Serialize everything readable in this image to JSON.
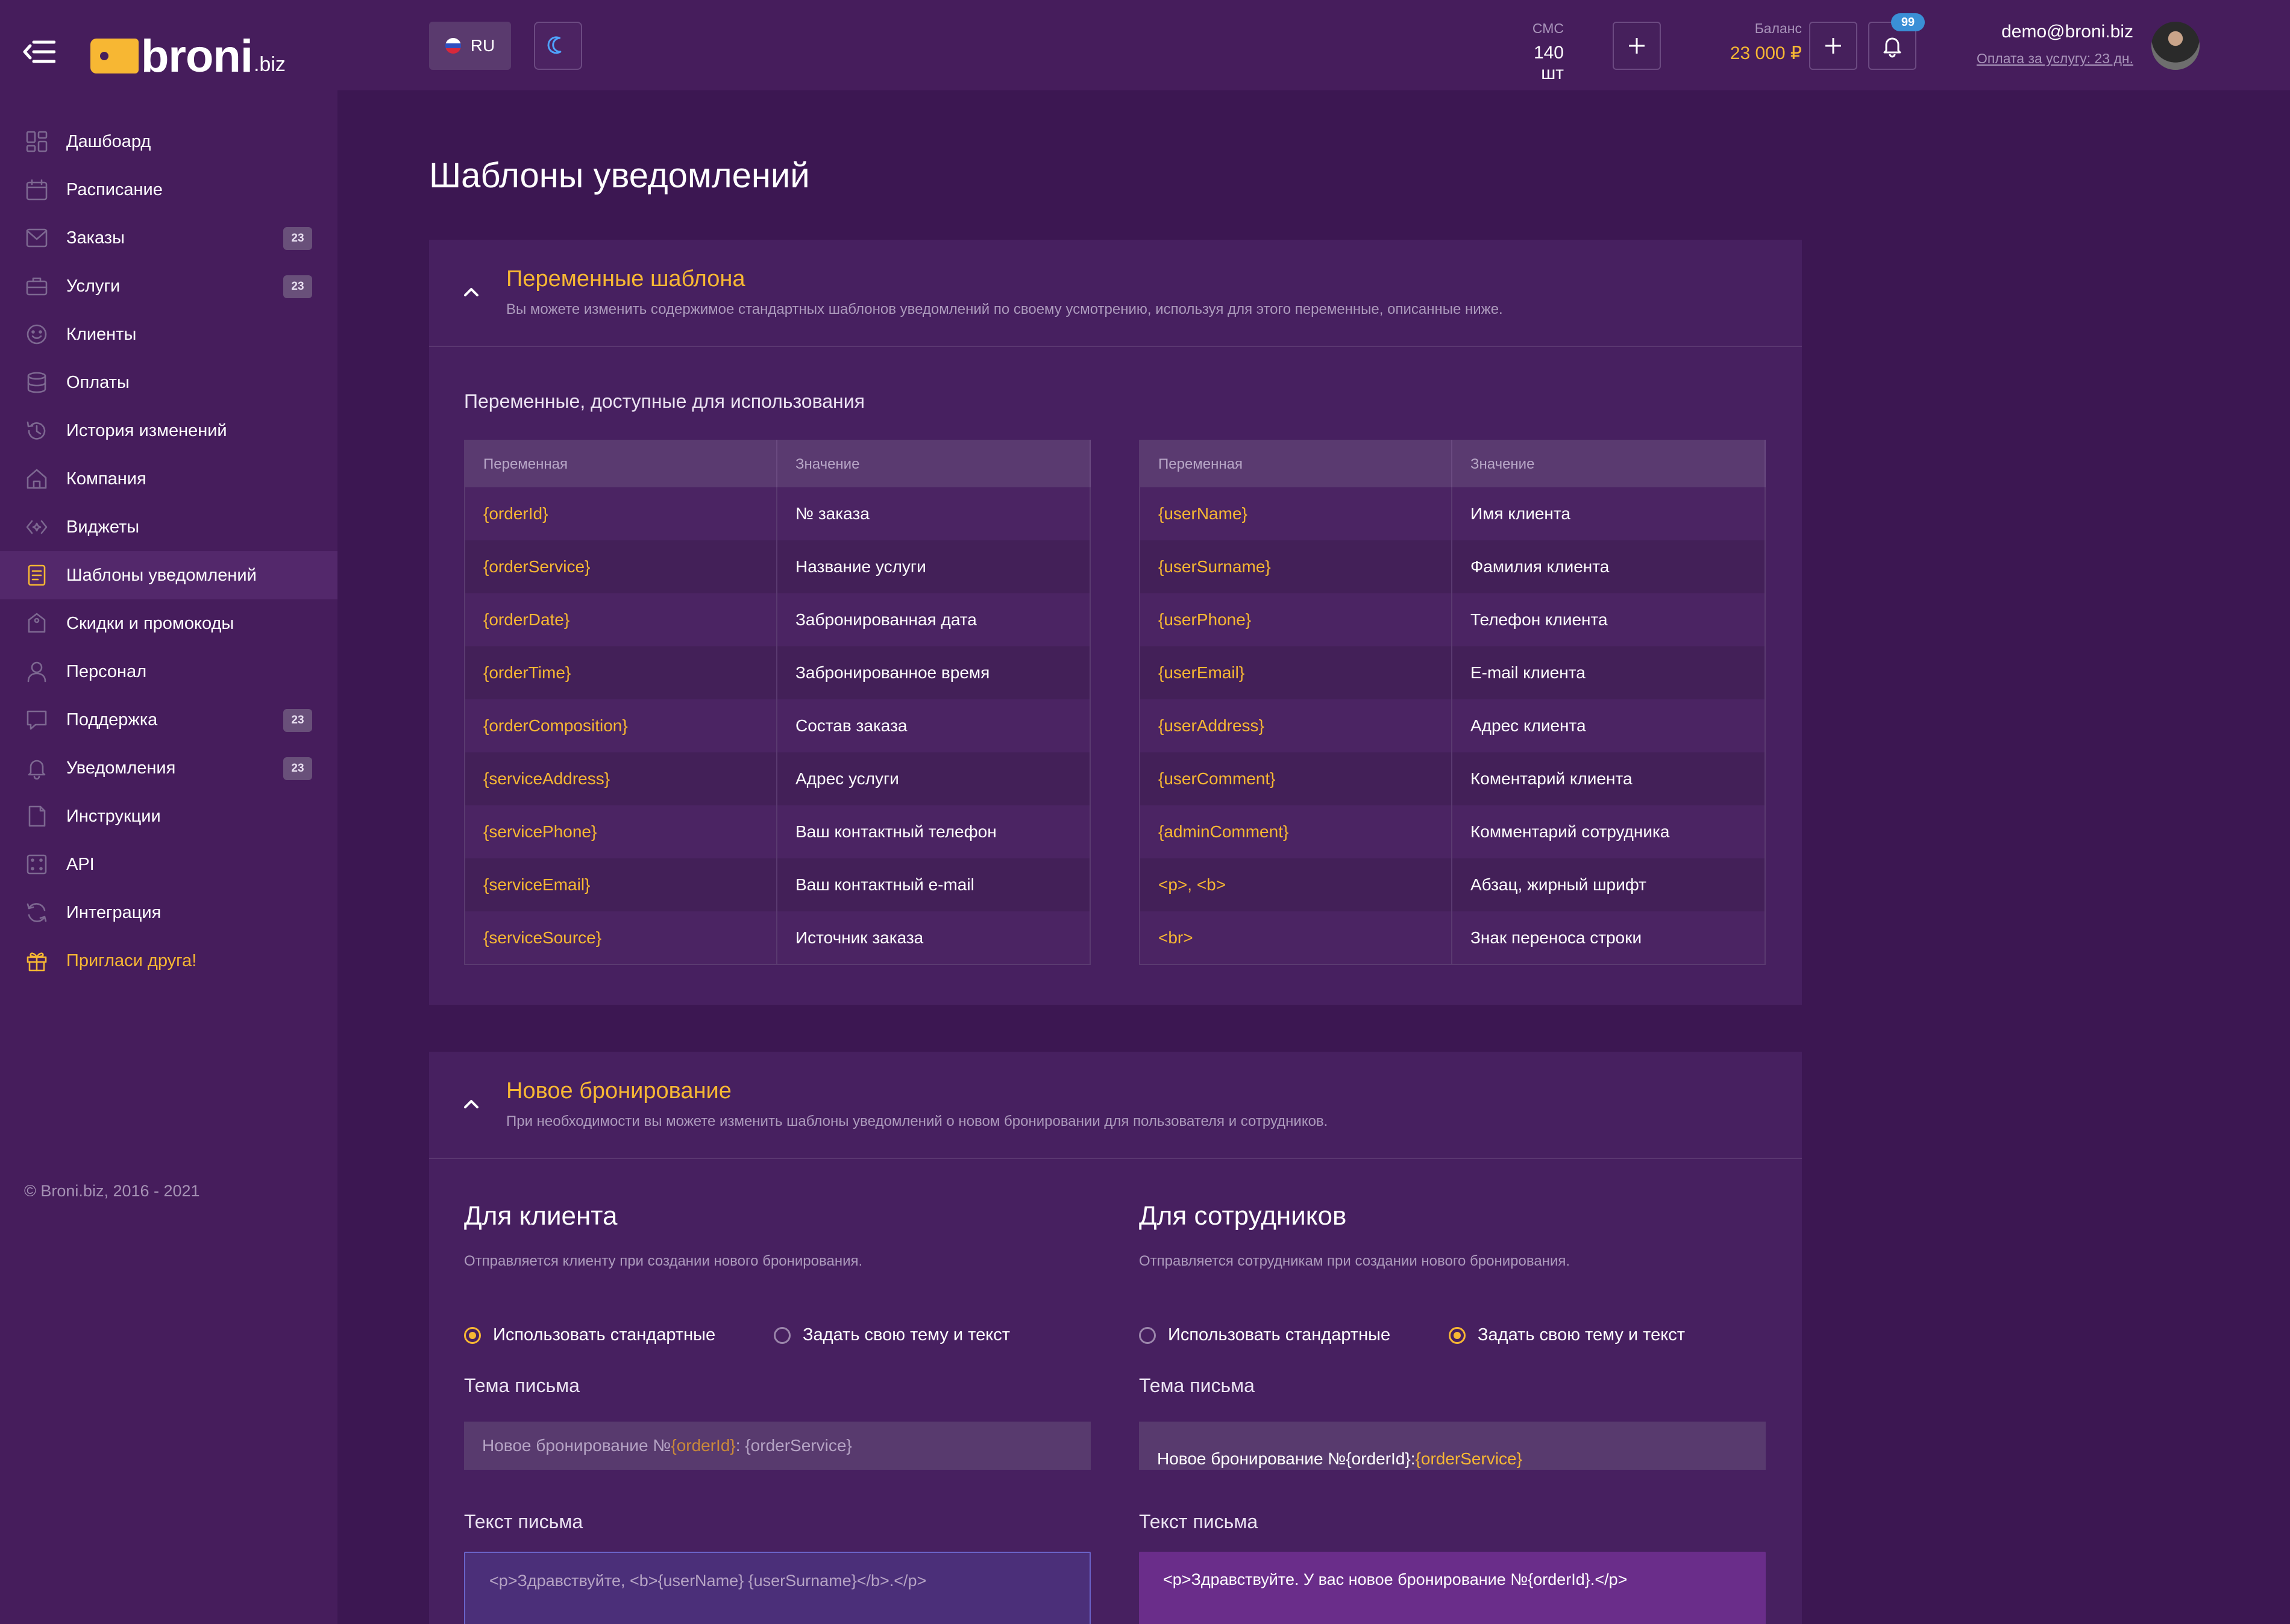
{
  "brand": {
    "logo_main": "broni",
    "logo_sub": ".biz"
  },
  "sidebar": {
    "items": [
      {
        "label": "Дашбоард",
        "icon": "dashboard-icon",
        "badge": ""
      },
      {
        "label": "Расписание",
        "icon": "calendar-icon",
        "badge": ""
      },
      {
        "label": "Заказы",
        "icon": "orders-icon",
        "badge": "23"
      },
      {
        "label": "Услуги",
        "icon": "briefcase-icon",
        "badge": "23"
      },
      {
        "label": "Клиенты",
        "icon": "smile-icon",
        "badge": ""
      },
      {
        "label": "Оплаты",
        "icon": "database-icon",
        "badge": ""
      },
      {
        "label": "История изменений",
        "icon": "history-icon",
        "badge": ""
      },
      {
        "label": "Компания",
        "icon": "home-icon",
        "badge": ""
      },
      {
        "label": "Виджеты",
        "icon": "widget-icon",
        "badge": ""
      },
      {
        "label": "Шаблоны уведомлений",
        "icon": "template-icon",
        "badge": ""
      },
      {
        "label": "Скидки и промокоды",
        "icon": "discount-icon",
        "badge": ""
      },
      {
        "label": "Персонал",
        "icon": "user-icon",
        "badge": ""
      },
      {
        "label": "Поддержка",
        "icon": "chat-icon",
        "badge": "23"
      },
      {
        "label": "Уведомления",
        "icon": "bell-icon",
        "badge": "23"
      },
      {
        "label": "Инструкции",
        "icon": "document-icon",
        "badge": ""
      },
      {
        "label": "API",
        "icon": "api-icon",
        "badge": ""
      },
      {
        "label": "Интеграция",
        "icon": "sync-icon",
        "badge": ""
      },
      {
        "label": "Пригласи друга!",
        "icon": "gift-icon",
        "badge": ""
      }
    ],
    "active_index": 9,
    "copyright": "© Broni.biz, 2016 - 2021"
  },
  "header": {
    "language": "RU",
    "sms": {
      "label": "СМС",
      "value": "140 шт"
    },
    "balance": {
      "label": "Баланс",
      "value": "23 000 ₽"
    },
    "notifications_count": "99",
    "user_email": "demo@broni.biz",
    "payment_info": "Оплата за услугу: 23 дн."
  },
  "page_title": "Шаблоны уведомлений",
  "variables_card": {
    "title": "Переменные шаблона",
    "subtitle": "Вы можете изменить содержимое стандартных шаблонов уведомлений по своему усмотрению, используя для этого переменные, описанные ниже.",
    "caption": "Переменные, доступные для использования",
    "col_var": "Переменная",
    "col_val": "Значение",
    "left": [
      {
        "var": "{orderId}",
        "val": "№ заказа"
      },
      {
        "var": "{orderService}",
        "val": "Название услуги"
      },
      {
        "var": "{orderDate}",
        "val": "Забронированная дата"
      },
      {
        "var": "{orderTime}",
        "val": "Забронированное время"
      },
      {
        "var": "{orderComposition}",
        "val": "Состав заказа"
      },
      {
        "var": "{serviceAddress}",
        "val": "Адрес услуги"
      },
      {
        "var": "{servicePhone}",
        "val": "Ваш контактный телефон"
      },
      {
        "var": "{serviceEmail}",
        "val": "Ваш контактный e-mail"
      },
      {
        "var": "{serviceSource}",
        "val": "Источник заказа"
      }
    ],
    "right": [
      {
        "var": "{userName}",
        "val": "Имя клиента"
      },
      {
        "var": "{userSurname}",
        "val": "Фамилия клиента"
      },
      {
        "var": "{userPhone}",
        "val": "Телефон клиента"
      },
      {
        "var": "{userEmail}",
        "val": "E-mail клиента"
      },
      {
        "var": "{userAddress}",
        "val": "Адрес клиента"
      },
      {
        "var": "{userComment}",
        "val": "Коментарий клиента"
      },
      {
        "var": "{adminComment}",
        "val": "Комментарий сотрудника"
      },
      {
        "var": "<p>, <b>",
        "val": "Абзац, жирный шрифт"
      },
      {
        "var": "<br>",
        "val": "Знак переноса строки"
      }
    ]
  },
  "booking_card": {
    "title": "Новое бронирование",
    "subtitle": "При необходимости вы можете изменить шаблоны уведомлений о новом бронировании для пользователя и сотрудников.",
    "client": {
      "title": "Для клиента",
      "subtitle": "Отправляется клиенту при создании нового бронирования.",
      "option_default": "Использовать стандартные",
      "option_custom": "Задать свою тему и текст",
      "selected": "default",
      "subject_label": "Тема письма",
      "subject_prefix": "Новое бронирование №",
      "subject_var": "{orderId}",
      "subject_suffix": ": {orderService}",
      "body_label": "Текст письма",
      "body": "<p>Здравствуйте, <b>{userName} {userSurname}</b>.</p>"
    },
    "staff": {
      "title": "Для сотрудников",
      "subtitle": "Отправляется сотрудникам при создании нового бронирования.",
      "option_default": "Использовать стандартные",
      "option_custom": "Задать свою тему и текст",
      "selected": "custom",
      "subject_label": "Тема письма",
      "subject_prefix": "Новое бронирование №{orderId}: ",
      "subject_var": "{orderService}",
      "body_label": "Текст письма",
      "body": "<p>Здравствуйте. У вас новое бронирование №{orderId}.</p>"
    }
  },
  "colors": {
    "accent": "#f7b733",
    "background": "#3c1752",
    "sidebar": "#461d5c",
    "card": "#472060",
    "badge_blue": "#3a8fd6"
  }
}
